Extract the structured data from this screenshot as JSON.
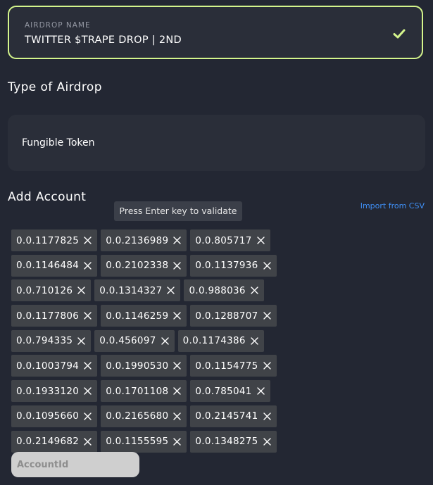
{
  "airdrop_name": {
    "label": "AIRDROP NAME",
    "value": "TWITTER $TRAPE DROP | 2ND",
    "status_icon": "check-icon",
    "accent_color": "#d4f58c"
  },
  "type_of_airdrop": {
    "title": "Type of Airdrop",
    "selected": "Fungible Token"
  },
  "add_account": {
    "title": "Add Account",
    "tooltip": "Press Enter key to validate",
    "import_link": "Import from CSV",
    "input_placeholder": "AccountId",
    "input_value": "",
    "accounts": [
      [
        "0.0.1177825",
        "0.0.2136989",
        "0.0.805717"
      ],
      [
        "0.0.1146484",
        "0.0.2102338",
        "0.0.1137936"
      ],
      [
        "0.0.710126",
        "0.0.1314327",
        "0.0.988036"
      ],
      [
        "0.0.1177806",
        "0.0.1146259",
        "0.0.1288707"
      ],
      [
        "0.0.794335",
        "0.0.456097",
        "0.0.1174386"
      ],
      [
        "0.0.1003794",
        "0.0.1990530",
        "0.0.1154775"
      ],
      [
        "0.0.1933120",
        "0.0.1701108",
        "0.0.785041"
      ],
      [
        "0.0.1095660",
        "0.0.2165680",
        "0.0.2145741"
      ],
      [
        "0.0.2149682",
        "0.0.1155595",
        "0.0.1348275"
      ]
    ]
  }
}
